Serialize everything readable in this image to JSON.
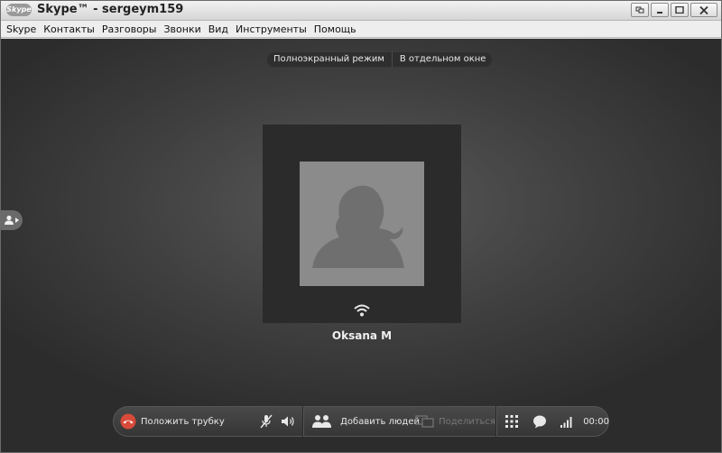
{
  "window": {
    "title": "Skype™ - sergeym159",
    "logo_text": "Skype"
  },
  "menu": {
    "items": [
      "Skype",
      "Контакты",
      "Разговоры",
      "Звонки",
      "Вид",
      "Инструменты",
      "Помощь"
    ]
  },
  "view_toggle": {
    "fullscreen_label": "Полноэкранный режим",
    "separate_window_label": "В отдельном окне"
  },
  "call": {
    "contact_name": "Oksana M"
  },
  "toolbar": {
    "hangup_label": "Положить трубку",
    "add_people_label": "Добавить людей",
    "share_label": "Поделиться",
    "timer": "00:00"
  },
  "colors": {
    "call_background": "#3f3f3f",
    "video_panel": "#2b2b2b",
    "avatar_background": "#8b8b8b",
    "hangup_red": "#d84a3a"
  }
}
